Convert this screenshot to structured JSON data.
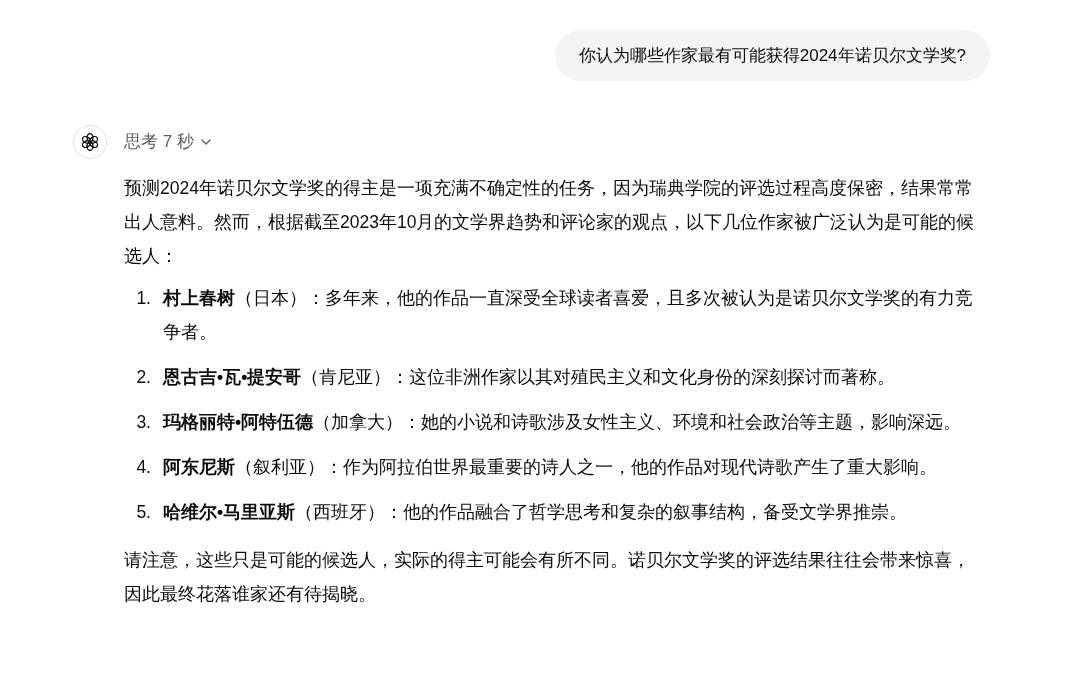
{
  "user_message": "你认为哪些作家最有可能获得2024年诺贝尔文学奖?",
  "assistant": {
    "thinking_label": "思考 7 秒",
    "expanded": false,
    "intro": "预测2024年诺贝尔文学奖的得主是一项充满不确定性的任务，因为瑞典学院的评选过程高度保密，结果常常出人意料。然而，根据截至2023年10月的文学界趋势和评论家的观点，以下几位作家被广泛认为是可能的候选人：",
    "items": [
      {
        "number": "1.",
        "text": "**村上春树**（日本）：多年来，他的作品一直深受全球读者喜爱，且多次被认为是诺贝尔文学奖的有力竞争者。"
      },
      {
        "number": "2.",
        "text": "**恩古吉•瓦•提安哥**（肯尼亚）：这位非洲作家以其对殖民主义和文化身份的深刻探讨而著称。"
      },
      {
        "number": "3.",
        "text": "**玛格丽特•阿特伍德**（加拿大）：她的小说和诗歌涉及女性主义、环境和社会政治等主题，影响深远。"
      },
      {
        "number": "4.",
        "text": "**阿东尼斯**（叙利亚）：作为阿拉伯世界最重要的诗人之一，他的作品对现代诗歌产生了重大影响。"
      },
      {
        "number": "5.",
        "text": "**哈维尔•马里亚斯**（西班牙）：他的作品融合了哲学思考和复杂的叙事结构，备受文学界推崇。"
      }
    ],
    "note": "请注意，这些只是可能的候选人，实际的得主可能会有所不同。诺贝尔文学奖的评选结果往往会带来惊喜，因此最终花落谁家还有待揭晓。"
  }
}
